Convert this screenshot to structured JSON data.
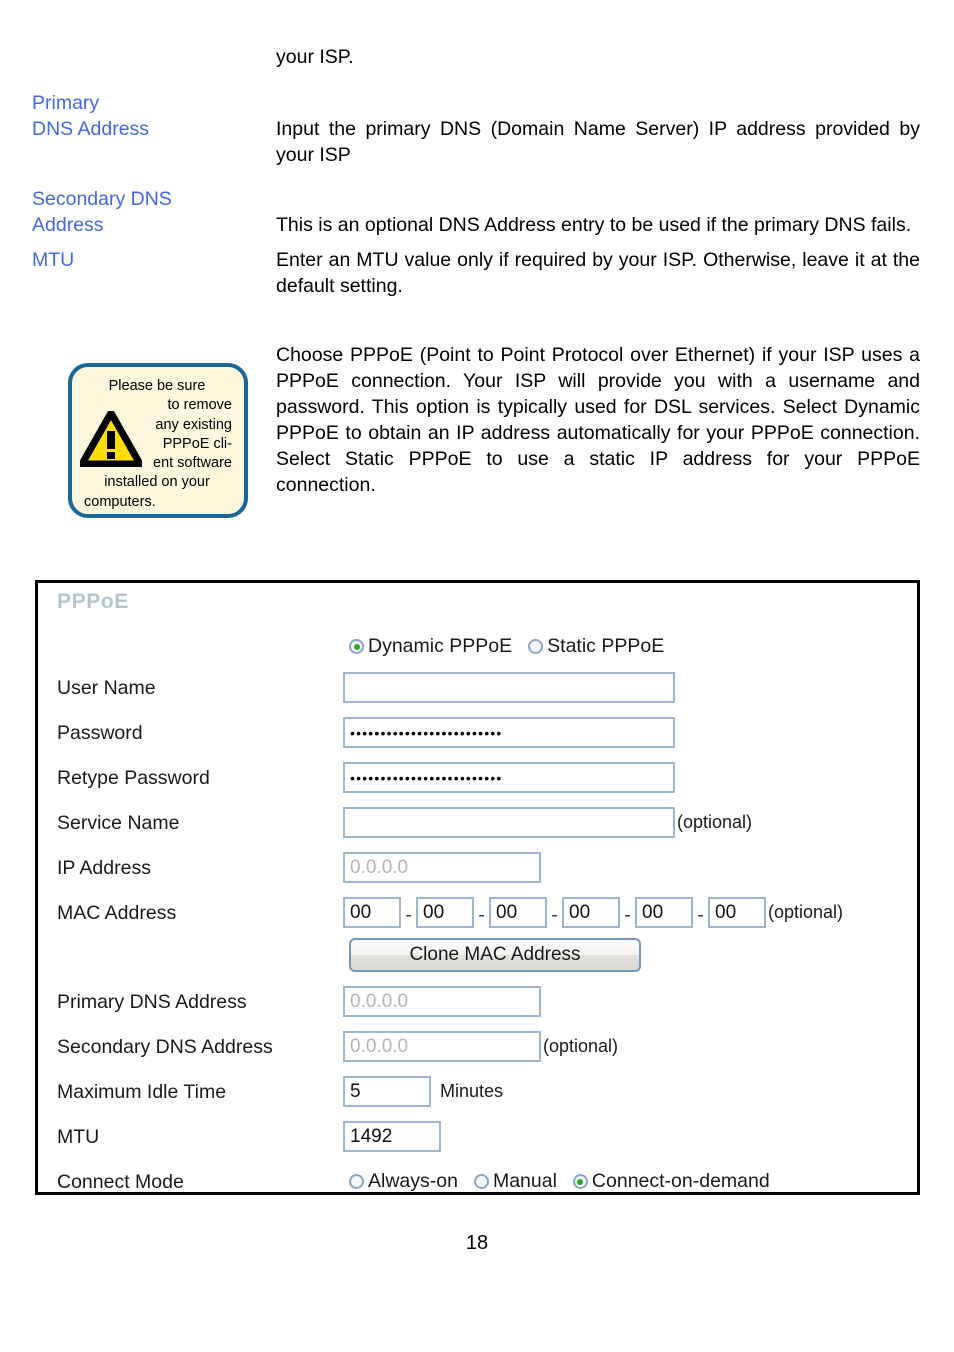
{
  "document": {
    "intro_continuation": "your ISP.",
    "definitions": [
      {
        "term": "Primary\nDNS Address",
        "term_line1": "Primary",
        "term_line2": "DNS Address",
        "description": "Input the primary DNS (Domain Name Server) IP address provided by your ISP"
      },
      {
        "term_line1": "Secondary DNS",
        "term_line2": "Address",
        "description": "This is an optional DNS Address entry to be used if the primary DNS fails."
      },
      {
        "term_line1": "MTU",
        "term_line2": "",
        "description": "Enter an MTU value only if required by your ISP. Otherwise, leave it at the default setting."
      }
    ],
    "warning": {
      "line1": "Please be sure",
      "line2": "to remove",
      "line3": "any existing",
      "line4": "PPPoE cli-",
      "line5": "ent software",
      "line6": "installed on your",
      "line7": "computers.",
      "icon": "warning-triangle-icon",
      "border_color": "#1a6699",
      "background_color": "#fbf8dd",
      "triangle_color": "#ffdd00"
    },
    "pppoe_paragraph": "Choose PPPoE (Point to Point Protocol over Ethernet) if your ISP uses a PPPoE connection. Your ISP will provide you with a username and password. This option is typically used for DSL services. Select Dynamic PPPoE to obtain an IP address automatically for your PPPoE connection. Select Static PPPoE to use a static IP address for your PPPoE connection.",
    "page_number": "18"
  },
  "panel": {
    "title": "PPPoE",
    "title_color": "#b3c6cc",
    "mode": {
      "options": [
        {
          "label": "Dynamic PPPoE",
          "selected": true
        },
        {
          "label": "Static PPPoE",
          "selected": false
        }
      ]
    },
    "fields": {
      "user_name": {
        "label": "User Name",
        "value": ""
      },
      "password": {
        "label": "Password",
        "value": "•••••••••••••••••••••••••"
      },
      "retype_password": {
        "label": "Retype Password",
        "value": "•••••••••••••••••••••••••"
      },
      "service_name": {
        "label": "Service Name",
        "value": "",
        "suffix": "(optional)"
      },
      "ip_address": {
        "label": "IP Address",
        "value": "0.0.0.0"
      },
      "mac_address": {
        "label": "MAC Address",
        "octets": [
          "00",
          "00",
          "00",
          "00",
          "00",
          "00"
        ],
        "separator": "-",
        "suffix": "(optional)"
      },
      "clone_mac": {
        "label": "Clone MAC Address"
      },
      "primary_dns": {
        "label": "Primary DNS Address",
        "value": "0.0.0.0"
      },
      "secondary_dns": {
        "label": "Secondary DNS Address",
        "value": "0.0.0.0",
        "suffix": "(optional)"
      },
      "max_idle_time": {
        "label": "Maximum Idle Time",
        "value": "5",
        "suffix": "Minutes"
      },
      "mtu": {
        "label": "MTU",
        "value": "1492"
      },
      "connect_mode": {
        "label": "Connect Mode",
        "options": [
          {
            "label": "Always-on",
            "selected": false
          },
          {
            "label": "Manual",
            "selected": false
          },
          {
            "label": "Connect-on-demand",
            "selected": true
          }
        ]
      }
    }
  },
  "colors": {
    "term_blue": "#4169e1",
    "input_border": "#9fb6d0",
    "radio_selected_dot": "#22aa22",
    "placeholder_gray": "#b6b6ae"
  }
}
